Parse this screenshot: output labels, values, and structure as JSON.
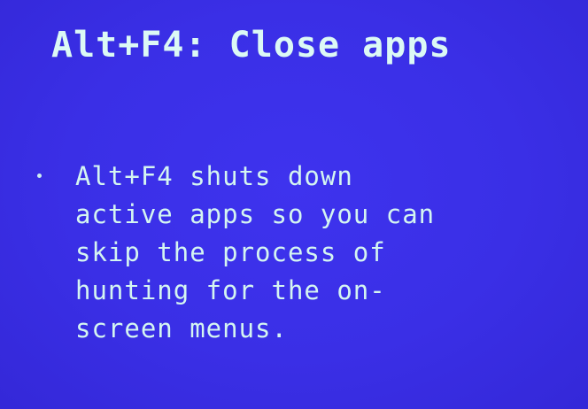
{
  "slide": {
    "title": "Alt+F4: Close apps",
    "bullets": [
      {
        "lines": [
          "Alt+F4 shuts down",
          "active apps so you can",
          "skip the process of",
          "hunting for the on-",
          "screen menus."
        ]
      }
    ]
  },
  "colors": {
    "background": "#3a2fe6",
    "text": "#d8f6f3"
  }
}
